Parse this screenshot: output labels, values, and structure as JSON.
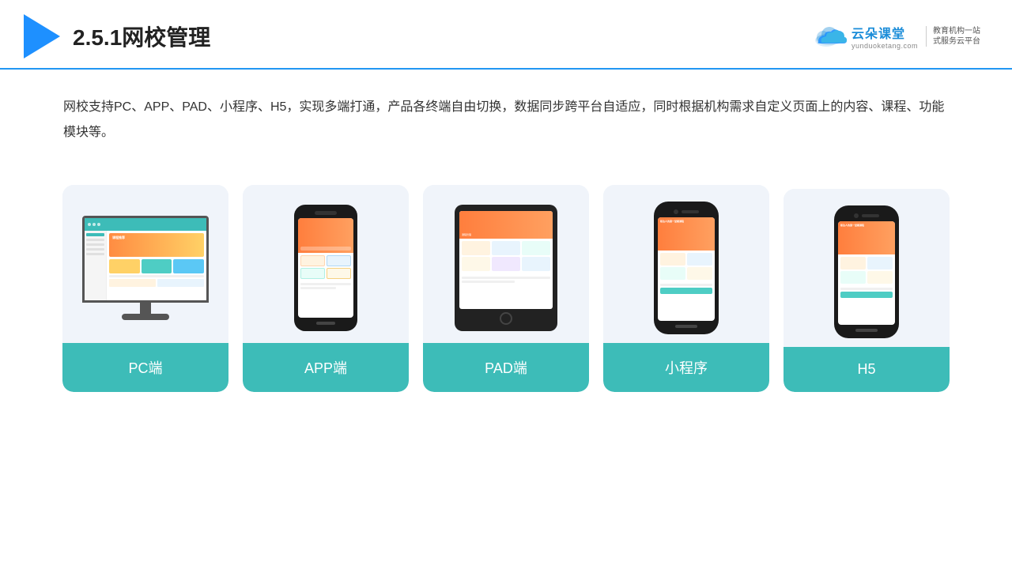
{
  "header": {
    "section_number": "2.5.1",
    "title": "网校管理",
    "brand_main": "云朵课堂",
    "brand_url": "yunduoketang.com",
    "brand_slogan_line1": "教育机构一站",
    "brand_slogan_line2": "式服务云平台"
  },
  "description": {
    "text": "网校支持PC、APP、PAD、小程序、H5，实现多端打通，产品各终端自由切换，数据同步跨平台自适应，同时根据机构需求自定义页面上的内容、课程、功能模块等。"
  },
  "cards": [
    {
      "id": "pc",
      "label": "PC端",
      "type": "monitor"
    },
    {
      "id": "app",
      "label": "APP端",
      "type": "phone"
    },
    {
      "id": "pad",
      "label": "PAD端",
      "type": "tablet"
    },
    {
      "id": "miniprogram",
      "label": "小程序",
      "type": "phone_notchless"
    },
    {
      "id": "h5",
      "label": "H5",
      "type": "phone_notchless"
    }
  ]
}
